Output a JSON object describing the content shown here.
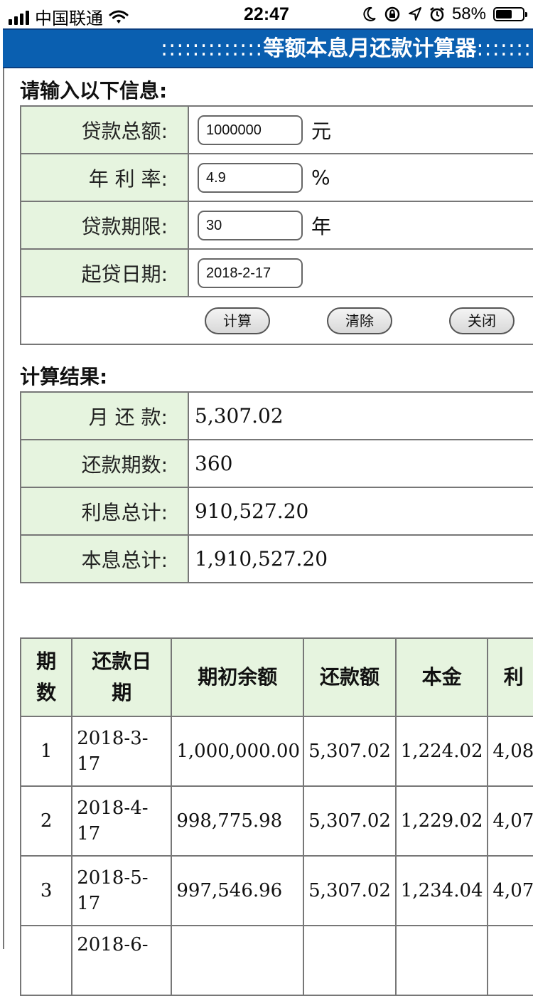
{
  "status_bar": {
    "carrier": "中国联通",
    "time": "22:47",
    "battery": "58%"
  },
  "title": {
    "dots_left": ":::::::::::::",
    "text": "等额本息月还款计算器",
    "dots_right": "::::::::::"
  },
  "input_section": {
    "heading": "请输入以下信息:",
    "fields": [
      {
        "label": "贷款总额:",
        "value": "1000000",
        "unit": "元"
      },
      {
        "label": "年 利 率:",
        "value": "4.9",
        "unit": "%"
      },
      {
        "label": "贷款期限:",
        "value": "30",
        "unit": "年"
      },
      {
        "label": "起贷日期:",
        "value": "2018-2-17",
        "unit": ""
      }
    ],
    "buttons": {
      "calc": "计算",
      "clear": "清除",
      "close": "关闭"
    }
  },
  "result_section": {
    "heading": "计算结果:",
    "rows": [
      {
        "label": "月 还 款:",
        "value": "5,307.02"
      },
      {
        "label": "还款期数:",
        "value": "360"
      },
      {
        "label": "利息总计:",
        "value": "910,527.20"
      },
      {
        "label": "本息总计:",
        "value": "1,910,527.20"
      }
    ]
  },
  "schedule": {
    "headers": {
      "period_l1": "期",
      "period_l2": "数",
      "date_l1": "还款日",
      "date_l2": "期",
      "opening": "期初余额",
      "payment": "还款额",
      "principal": "本金",
      "interest": "利"
    },
    "rows": [
      {
        "period": "1",
        "date": "2018-3-17",
        "opening": "1,000,000.00",
        "payment": "5,307.02",
        "principal": "1,224.02",
        "interest": "4,08"
      },
      {
        "period": "2",
        "date": "2018-4-17",
        "opening": "998,775.98",
        "payment": "5,307.02",
        "principal": "1,229.02",
        "interest": "4,07"
      },
      {
        "period": "3",
        "date": "2018-5-17",
        "opening": "997,546.96",
        "payment": "5,307.02",
        "principal": "1,234.04",
        "interest": "4,07"
      },
      {
        "period": "",
        "date": "2018-6-",
        "opening": "",
        "payment": "",
        "principal": "",
        "interest": ""
      }
    ]
  }
}
